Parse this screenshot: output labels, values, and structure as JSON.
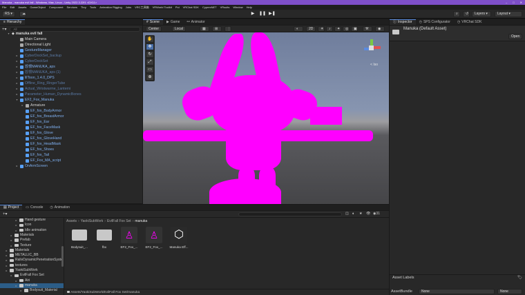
{
  "window": {
    "title": "Manuka - manuka evil fall - Windows, Mac, Linux - Unity 2022.3.22f1 <DX11>"
  },
  "menu": [
    "File",
    "Edit",
    "Assets",
    "GameObject",
    "Component",
    "Services",
    "Thry",
    "Tools",
    "Animation Rigging",
    "Jobs",
    "VRC工具箱",
    "VRWorld Toolkit",
    "Poi",
    "VRChat SDK",
    "CyprexNET",
    "VRsuits",
    "Window",
    "Help"
  ],
  "toolbar": {
    "account": "RS",
    "layers": "Layers",
    "layout": "Layout"
  },
  "hierarchy": {
    "tab": "Hierarchy",
    "search_placeholder": "All",
    "scene_name": "manuka evil fall",
    "items": [
      {
        "label": "Main Camera",
        "indent": 1,
        "kind": "object",
        "dim": false,
        "arrow": false
      },
      {
        "label": "Directional Light",
        "indent": 1,
        "kind": "object",
        "dim": false,
        "arrow": false
      },
      {
        "label": "GestureManager",
        "indent": 1,
        "kind": "prefab",
        "dim": false,
        "arrow": false
      },
      {
        "label": "CyberDockSet_backup",
        "indent": 1,
        "kind": "prefab",
        "dim": true,
        "arrow": true
      },
      {
        "label": "CyberDockSet",
        "indent": 1,
        "kind": "prefab",
        "dim": true,
        "arrow": true
      },
      {
        "label": "怨恨MANUKA_aps",
        "indent": 1,
        "kind": "prefab",
        "dim": false,
        "arrow": true
      },
      {
        "label": "怨恨MANUKA_aps (1)",
        "indent": 1,
        "kind": "prefab",
        "dim": true,
        "arrow": true
      },
      {
        "label": "lilToon_1.4.0_DPS",
        "indent": 1,
        "kind": "prefab",
        "dim": false,
        "arrow": true
      },
      {
        "label": "Offline_Ring_RingerTube",
        "indent": 1,
        "kind": "prefab",
        "dim": true,
        "arrow": true
      },
      {
        "label": "Actual_Wristwarme_Lanterni",
        "indent": 1,
        "kind": "prefab",
        "dim": true,
        "arrow": true
      },
      {
        "label": "Parameter_Human_DynamicBones",
        "indent": 1,
        "kind": "prefab",
        "dim": true,
        "arrow": true
      },
      {
        "label": "EF2_Fox_Manuka",
        "indent": 1,
        "kind": "prefab",
        "dim": false,
        "arrow": true,
        "open": true
      },
      {
        "label": "Armature",
        "indent": 2,
        "kind": "object",
        "dim": false,
        "arrow": true
      },
      {
        "label": "EF_fox_BodyArmor",
        "indent": 2,
        "kind": "prefab",
        "dim": false,
        "arrow": false
      },
      {
        "label": "EF_fox_BreastArmor",
        "indent": 2,
        "kind": "prefab",
        "dim": false,
        "arrow": false
      },
      {
        "label": "EF_fox_Ear",
        "indent": 2,
        "kind": "prefab",
        "dim": false,
        "arrow": false
      },
      {
        "label": "EF_fox_FaceMask",
        "indent": 2,
        "kind": "prefab",
        "dim": false,
        "arrow": false
      },
      {
        "label": "EF_fox_Glove",
        "indent": 2,
        "kind": "prefab",
        "dim": false,
        "arrow": false
      },
      {
        "label": "EF_fox_GloveHand",
        "indent": 2,
        "kind": "prefab",
        "dim": false,
        "arrow": false
      },
      {
        "label": "EF_fox_HeadMask",
        "indent": 2,
        "kind": "prefab",
        "dim": false,
        "arrow": false
      },
      {
        "label": "EF_fox_Shoes",
        "indent": 2,
        "kind": "prefab",
        "dim": false,
        "arrow": false
      },
      {
        "label": "EF_fox_Tail",
        "indent": 2,
        "kind": "prefab",
        "dim": false,
        "arrow": false
      },
      {
        "label": "EF_Fox_MA_script",
        "indent": 2,
        "kind": "prefab",
        "dim": false,
        "arrow": false
      },
      {
        "label": "OnArmScreen",
        "indent": 1,
        "kind": "prefab",
        "dim": false,
        "arrow": true
      }
    ]
  },
  "scene": {
    "tabs": [
      "Scene",
      "Game",
      "Animator"
    ],
    "pivot": "Center",
    "space": "Local",
    "mode_2d": "2D",
    "gizmo_label": "< Iso"
  },
  "inspector": {
    "tabs": [
      "Inspector",
      "SPS Configurator",
      "VRChat SDK"
    ],
    "asset_title": "Manuka (Default Asset)",
    "open_button": "Open",
    "asset_labels": "Asset Labels",
    "asset_bundle": "AssetBundle",
    "bundle_value": "None",
    "variant_value": "None"
  },
  "project": {
    "tabs": [
      "Project",
      "Console",
      "Animation"
    ],
    "breadcrumb": [
      "Assets",
      "YaokiSubWork",
      "EvilFall Fox Set",
      "manuka"
    ],
    "count": "31",
    "tree": [
      {
        "label": "Hand gesture",
        "indent": 3
      },
      {
        "label": "Icon",
        "indent": 3
      },
      {
        "label": "Idle animation",
        "indent": 3
      },
      {
        "label": "Materials",
        "indent": 2
      },
      {
        "label": "Prefab",
        "indent": 2
      },
      {
        "label": "Texture",
        "indent": 2
      },
      {
        "label": "Materials",
        "indent": 1
      },
      {
        "label": "METALLIC_BB",
        "indent": 1
      },
      {
        "label": "RalivDynamicPenetrationSystem",
        "indent": 1
      },
      {
        "label": "textures",
        "indent": 1
      },
      {
        "label": "YaokiSubWork",
        "indent": 1
      },
      {
        "label": "EvilFall Fox Set",
        "indent": 2
      },
      {
        "label": "Airi",
        "indent": 3
      },
      {
        "label": "manuka",
        "indent": 3,
        "selected": true
      },
      {
        "label": "Bodysuit_Material",
        "indent": 4
      }
    ],
    "assets": [
      {
        "name": "Bodysuit_...",
        "kind": "folder"
      },
      {
        "name": "fbx",
        "kind": "folder"
      },
      {
        "name": "EF2_Fox_...",
        "kind": "prefab"
      },
      {
        "name": "EF2_Fox_...",
        "kind": "prefab"
      },
      {
        "name": "Manuka Eff...",
        "kind": "unity"
      }
    ],
    "footer_path": "Assets/YaokiSubWork/EvilFall Fox Set/manuka"
  }
}
